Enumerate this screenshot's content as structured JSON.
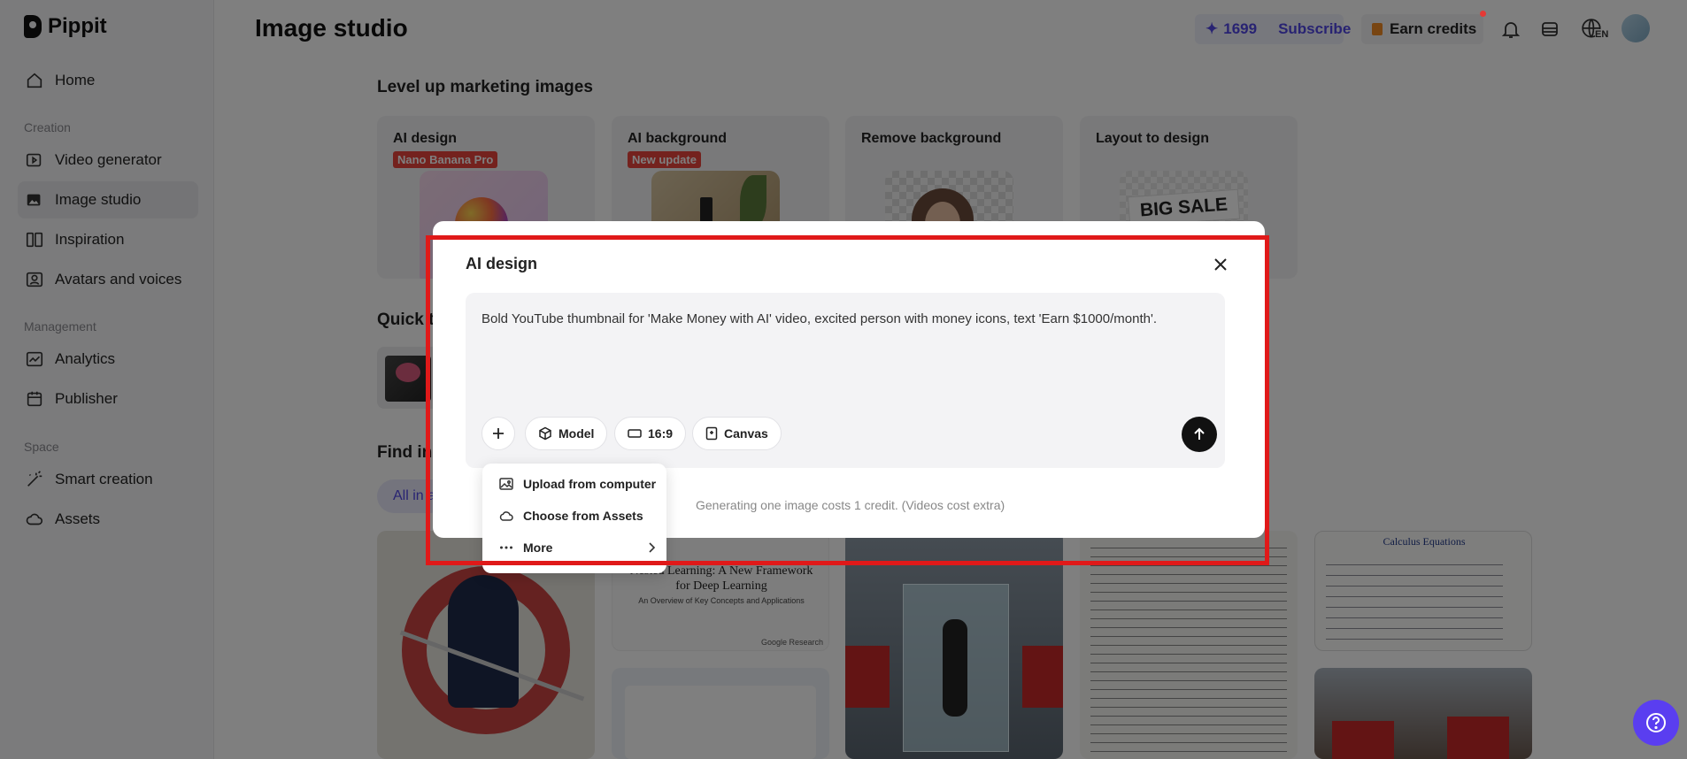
{
  "app": {
    "name": "Pippit"
  },
  "sidebar": {
    "home": "Home",
    "sections": {
      "creation": "Creation",
      "management": "Management",
      "space": "Space"
    },
    "creation_items": [
      "Video generator",
      "Image studio",
      "Inspiration",
      "Avatars and voices"
    ],
    "management_items": [
      "Analytics",
      "Publisher"
    ],
    "space_items": [
      "Smart creation",
      "Assets"
    ]
  },
  "header": {
    "title": "Image studio",
    "credits": "1699",
    "subscribe": "Subscribe",
    "earn": "Earn credits",
    "lang": "EN"
  },
  "main": {
    "section1": "Level up marketing images",
    "cards": [
      {
        "title": "AI design",
        "badge": "Nano Banana Pro"
      },
      {
        "title": "AI background",
        "badge": "New update"
      },
      {
        "title": "Remove background"
      },
      {
        "title": "Layout to design",
        "thumb_text": "BIG SALE"
      }
    ],
    "section2": "Quick t",
    "section3": "Find in s",
    "filter": "All in a",
    "gallery": {
      "paper_title": "Nested Learning: A New Framework for Deep Learning",
      "paper_sub": "An Overview of Key Concepts and Applications",
      "paper_source": "Google Research",
      "math_title": "Calculus Equations"
    }
  },
  "modal": {
    "title": "AI design",
    "prompt": "Bold YouTube thumbnail for 'Make Money with AI' video, excited person with money icons, text 'Earn $1000/month'.",
    "model": "Model",
    "ratio": "16:9",
    "canvas": "Canvas",
    "note": "Generating one image costs 1 credit. (Videos cost extra)"
  },
  "menu": {
    "items": [
      "Upload from computer",
      "Choose from Assets",
      "More"
    ]
  },
  "colors": {
    "accent": "#5046e5",
    "highlight": "#e01919",
    "badge": "#e8453c",
    "help": "#5a3ef0"
  }
}
